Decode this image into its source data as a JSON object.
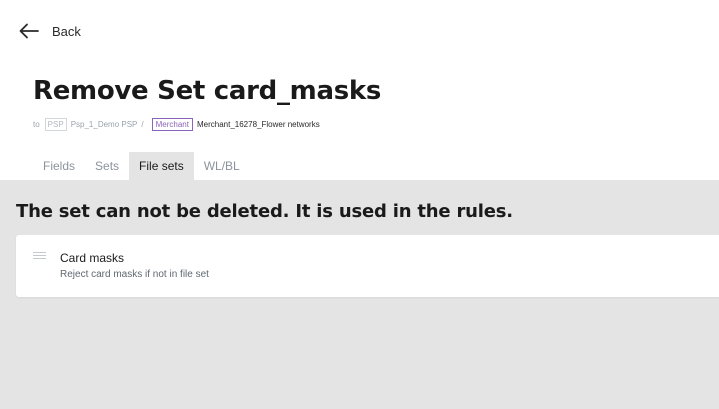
{
  "header": {
    "back_label": "Back",
    "title": "Remove Set card_masks"
  },
  "breadcrumb": {
    "to": "to",
    "psp_tag": "PSP",
    "psp_name": "Psp_1_Demo PSP",
    "separator": "/",
    "merchant_tag": "Merchant",
    "merchant_name": "Merchant_16278_Flower networks"
  },
  "tabs": [
    {
      "label": "Fields",
      "active": false
    },
    {
      "label": "Sets",
      "active": false
    },
    {
      "label": "File sets",
      "active": true
    },
    {
      "label": "WL/BL",
      "active": false
    }
  ],
  "main": {
    "warning": "The set can not be deleted. It is used in the rules.",
    "rules": [
      {
        "name": "Card masks",
        "description": "Reject card masks if not in file set"
      }
    ]
  },
  "colors": {
    "content_bg": "#e4e4e4",
    "merchant_accent": "#8a64b8"
  }
}
